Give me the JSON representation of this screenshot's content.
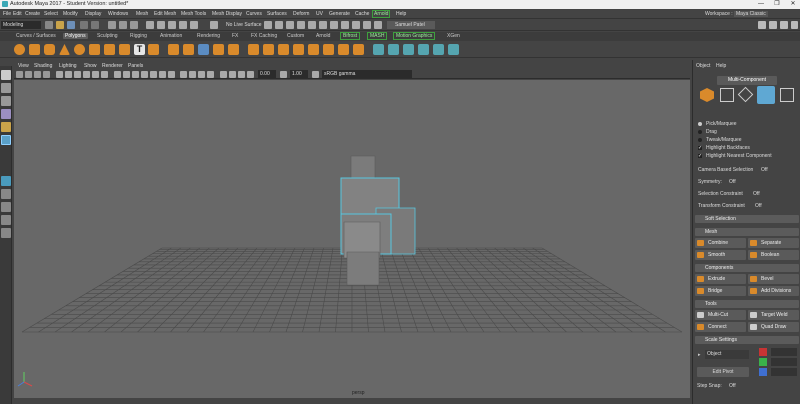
{
  "window": {
    "title": "Autodesk Maya 2017 - Student Version: untitled*",
    "controls": [
      "—",
      "❐",
      "✕"
    ]
  },
  "menubar": {
    "items": [
      "File",
      "Edit",
      "Create",
      "Select",
      "Modify",
      "Display",
      "Windows",
      "Mesh",
      "Edit Mesh",
      "Mesh Tools",
      "Mesh Display",
      "Curves",
      "Surfaces",
      "Deform",
      "UV",
      "Generate",
      "Cache",
      "Arnold",
      "Help"
    ],
    "highlighted": "Arnold",
    "workspace_label": "Workspace :",
    "workspace_value": "Maya Classic"
  },
  "statusline": {
    "mode": "Modeling",
    "live_surface": "No Live Surface",
    "user": "Samuel Patel"
  },
  "shelf_tabs": [
    "Curves / Surfaces",
    "Polygons",
    "Sculpting",
    "Rigging",
    "Animation",
    "Rendering",
    "FX",
    "FX Caching",
    "Custom",
    "Arnold",
    "Bifrost",
    "MASH",
    "Motion Graphics",
    "XGen"
  ],
  "shelf_active": "Polygons",
  "shelf_highlighted": [
    "Bifrost",
    "MASH",
    "Motion Graphics"
  ],
  "viewport": {
    "menus": [
      "View",
      "Shading",
      "Lighting",
      "Show",
      "Renderer",
      "Panels"
    ],
    "field1": "0.00",
    "field2": "1.00",
    "colorspace": "sRGB gamma",
    "camera": "persp"
  },
  "right_panel": {
    "menu": [
      "Object",
      "Help"
    ],
    "tab": "Multi-Component",
    "options": [
      "Pick/Marquee",
      "Drag",
      "Tweak/Marquee",
      "Highlight Backfaces",
      "Highlight Nearest Component"
    ],
    "camera_based_label": "Camera Based Selection",
    "camera_based_value": "Off",
    "symmetry_label": "Symmetry:",
    "symmetry_value": "Off",
    "sel_constraint_label": "Selection Constraint",
    "sel_constraint_value": "Off",
    "transform_constraint_label": "Transform Constraint",
    "transform_constraint_value": "Off",
    "soft_selection": "Soft Selection",
    "mesh_header": "Mesh",
    "mesh_buttons": [
      "Combine",
      "Separate",
      "Smooth",
      "Boolean"
    ],
    "components_header": "Components",
    "component_buttons": [
      "Extrude",
      "Bevel",
      "Bridge",
      "Add Divisions"
    ],
    "tools_header": "Tools",
    "tool_buttons": [
      "Multi-Cut",
      "Target Weld",
      "Connect",
      "Quad Draw"
    ],
    "scale_header": "Scale Settings",
    "scale_space": "Object",
    "edit_pivot": "Edit Pivot",
    "step_snap_label": "Step Snap:",
    "step_snap_value": "Off"
  },
  "colors": {
    "accent": "#5fa8d3",
    "selection": "#57c7e0",
    "orange": "#d98a2b"
  }
}
